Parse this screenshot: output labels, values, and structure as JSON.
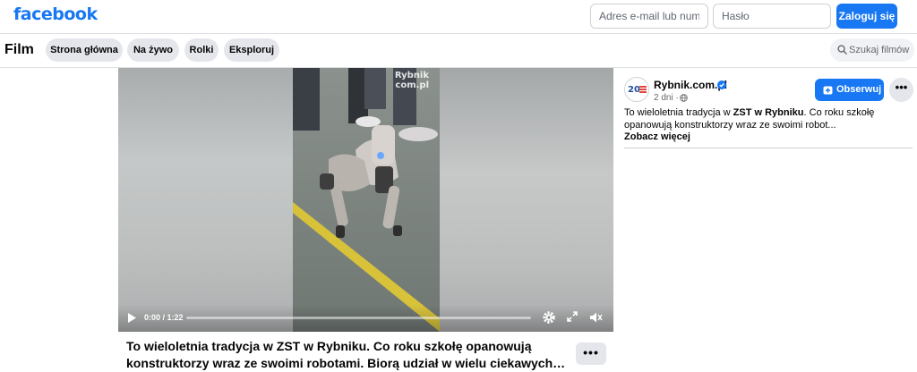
{
  "header": {
    "logo": "facebook",
    "email_placeholder": "Adres e-mail lub numer",
    "password_placeholder": "Hasło",
    "login_label": "Zaloguj się"
  },
  "nav": {
    "title": "Film",
    "tabs": [
      "Strona główna",
      "Na żywo",
      "Rolki",
      "Eksploruj"
    ],
    "search_placeholder": "Szukaj filmów"
  },
  "video": {
    "watermark_line1": "Rybnik",
    "watermark_line2": "com.pl",
    "time": "0:00 / 1:22",
    "progress": 0.0,
    "title": "To wieloletnia tradycja w ZST w Rybniku. Co roku szkołę opanowują konstruktorzy wraz ze swoimi robotami. Biorą udział w wielu ciekawych…",
    "more_label": "•••"
  },
  "post": {
    "avatar_text": "20",
    "page_name": "Rybnik.com.pl",
    "age": "2 dni",
    "meta_separator": "·",
    "follow_label": "Obserwuj",
    "dots_label": "•••",
    "desc_prefix": "To wieloletnia tradycja w ",
    "desc_bold": "ZST w Rybniku",
    "desc_suffix": ". Co roku szkołę opanowują konstruktorzy wraz ze swoimi robot...",
    "see_more": "Zobacz więcej"
  },
  "colors": {
    "brand": "#1877f2",
    "pill_bg": "#e4e6eb",
    "muted": "#65676b"
  }
}
